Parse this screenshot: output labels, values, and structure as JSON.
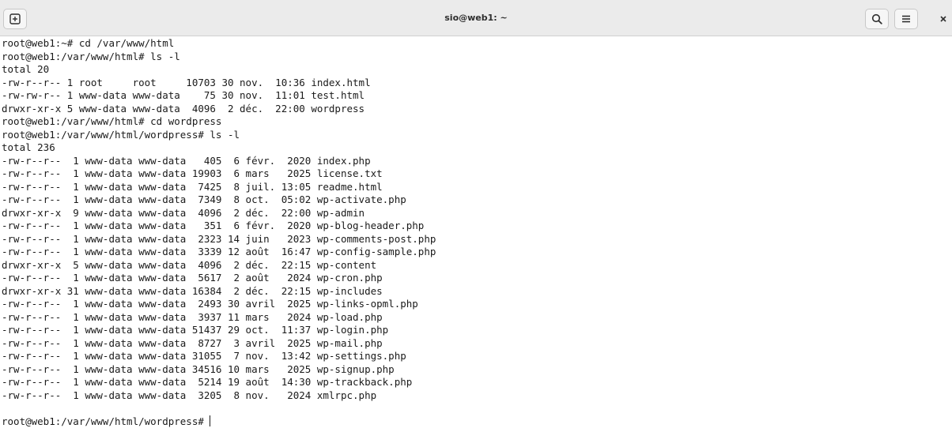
{
  "window": {
    "title": "sio@web1: ~"
  },
  "header_buttons": {
    "new_tab": "new-tab-icon",
    "search": "search-icon",
    "menu": "hamburger-menu-icon",
    "close": "close-icon"
  },
  "terminal": {
    "lines": [
      "root@web1:~# cd /var/www/html",
      "root@web1:/var/www/html# ls -l",
      "total 20",
      "-rw-r--r-- 1 root     root     10703 30 nov.  10:36 index.html",
      "-rw-rw-r-- 1 www-data www-data    75 30 nov.  11:01 test.html",
      "drwxr-xr-x 5 www-data www-data  4096  2 déc.  22:00 wordpress",
      "root@web1:/var/www/html# cd wordpress",
      "root@web1:/var/www/html/wordpress# ls -l",
      "total 236",
      "-rw-r--r--  1 www-data www-data   405  6 févr.  2020 index.php",
      "-rw-r--r--  1 www-data www-data 19903  6 mars   2025 license.txt",
      "-rw-r--r--  1 www-data www-data  7425  8 juil. 13:05 readme.html",
      "-rw-r--r--  1 www-data www-data  7349  8 oct.  05:02 wp-activate.php",
      "drwxr-xr-x  9 www-data www-data  4096  2 déc.  22:00 wp-admin",
      "-rw-r--r--  1 www-data www-data   351  6 févr.  2020 wp-blog-header.php",
      "-rw-r--r--  1 www-data www-data  2323 14 juin   2023 wp-comments-post.php",
      "-rw-r--r--  1 www-data www-data  3339 12 août  16:47 wp-config-sample.php",
      "drwxr-xr-x  5 www-data www-data  4096  2 déc.  22:15 wp-content",
      "-rw-r--r--  1 www-data www-data  5617  2 août   2024 wp-cron.php",
      "drwxr-xr-x 31 www-data www-data 16384  2 déc.  22:15 wp-includes",
      "-rw-r--r--  1 www-data www-data  2493 30 avril  2025 wp-links-opml.php",
      "-rw-r--r--  1 www-data www-data  3937 11 mars   2024 wp-load.php",
      "-rw-r--r--  1 www-data www-data 51437 29 oct.  11:37 wp-login.php",
      "-rw-r--r--  1 www-data www-data  8727  3 avril  2025 wp-mail.php",
      "-rw-r--r--  1 www-data www-data 31055  7 nov.  13:42 wp-settings.php",
      "-rw-r--r--  1 www-data www-data 34516 10 mars   2025 wp-signup.php",
      "-rw-r--r--  1 www-data www-data  5214 19 août  14:30 wp-trackback.php",
      "-rw-r--r--  1 www-data www-data  3205  8 nov.   2024 xmlrpc.php"
    ],
    "prompt": "root@web1:/var/www/html/wordpress# "
  }
}
